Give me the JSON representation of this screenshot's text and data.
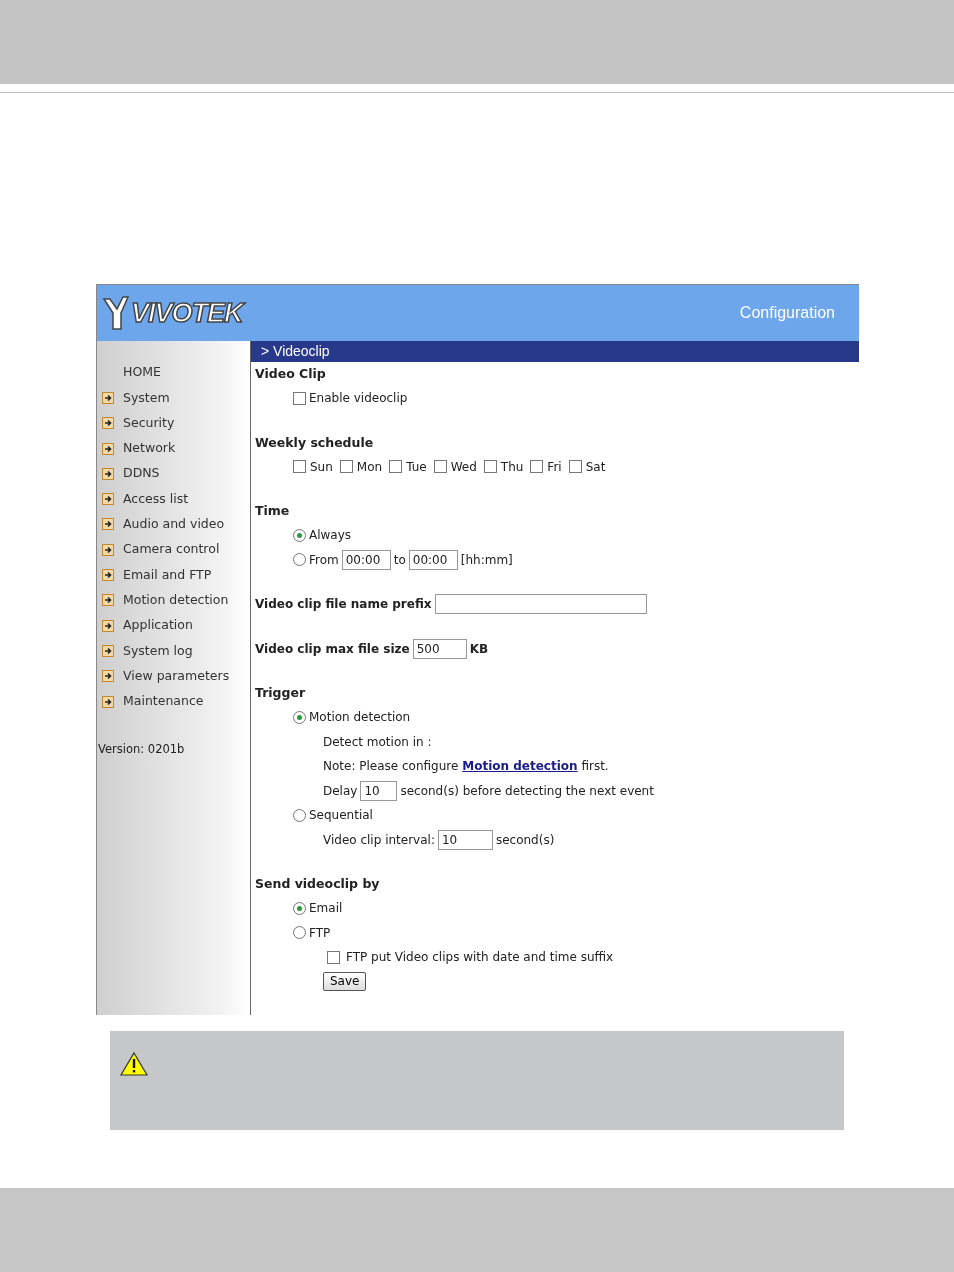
{
  "banner": {
    "logo": "VIVOTEK",
    "title": "Configuration"
  },
  "sidebar": {
    "items": [
      {
        "label": "HOME",
        "kind": "home"
      },
      {
        "label": "System",
        "kind": "page"
      },
      {
        "label": "Security",
        "kind": "page"
      },
      {
        "label": "Network",
        "kind": "page"
      },
      {
        "label": "DDNS",
        "kind": "page"
      },
      {
        "label": "Access list",
        "kind": "page"
      },
      {
        "label": "Audio and video",
        "kind": "page"
      },
      {
        "label": "Camera control",
        "kind": "page"
      },
      {
        "label": "Email and FTP",
        "kind": "page"
      },
      {
        "label": "Motion detection",
        "kind": "page"
      },
      {
        "label": "Application",
        "kind": "page"
      },
      {
        "label": "System log",
        "kind": "page"
      },
      {
        "label": "View parameters",
        "kind": "page"
      },
      {
        "label": "Maintenance",
        "kind": "page"
      }
    ],
    "version": "Version: 0201b"
  },
  "content": {
    "title": "> Videoclip",
    "video_clip": {
      "heading": "Video Clip",
      "enable": {
        "label": "Enable videoclip",
        "checked": false
      }
    },
    "weekly_schedule": {
      "heading": "Weekly schedule",
      "days": [
        {
          "label": "Sun",
          "checked": false
        },
        {
          "label": "Mon",
          "checked": false
        },
        {
          "label": "Tue",
          "checked": false
        },
        {
          "label": "Wed",
          "checked": false
        },
        {
          "label": "Thu",
          "checked": false
        },
        {
          "label": "Fri",
          "checked": false
        },
        {
          "label": "Sat",
          "checked": false
        }
      ]
    },
    "time": {
      "heading": "Time",
      "always": {
        "label": "Always",
        "selected": true
      },
      "from": {
        "label": "From",
        "selected": false,
        "start": "00:00",
        "to": "to",
        "end": "00:00",
        "format": "[hh:mm]"
      }
    },
    "prefix": {
      "label": "Video clip file name prefix"
    },
    "max_size": {
      "label": "Video clip max file size",
      "value": "500",
      "unit": "KB"
    },
    "trigger": {
      "heading": "Trigger",
      "motion": {
        "label": "Motion detection",
        "selected": true,
        "detect": "Detect motion in :",
        "note": "Note: Please configure ",
        "note_link": "Motion detection",
        "note_end": "first.",
        "delay_label": "Delay",
        "delay": "10",
        "delay_unit": "second(s) before detecting the next event"
      },
      "sequential": {
        "label": "Sequential",
        "selected": false,
        "interval_label": "Video clip interval:",
        "interval": "10",
        "interval_unit": "second(s)"
      }
    },
    "send": {
      "heading": "Send videoclip by",
      "options": [
        {
          "label": "Email",
          "selected": true
        },
        {
          "label": "FTP",
          "selected": false
        }
      ],
      "ftp_suffix": {
        "label": "FTP put Video clips with date and time suffix",
        "checked": false
      }
    },
    "save": "Save"
  }
}
